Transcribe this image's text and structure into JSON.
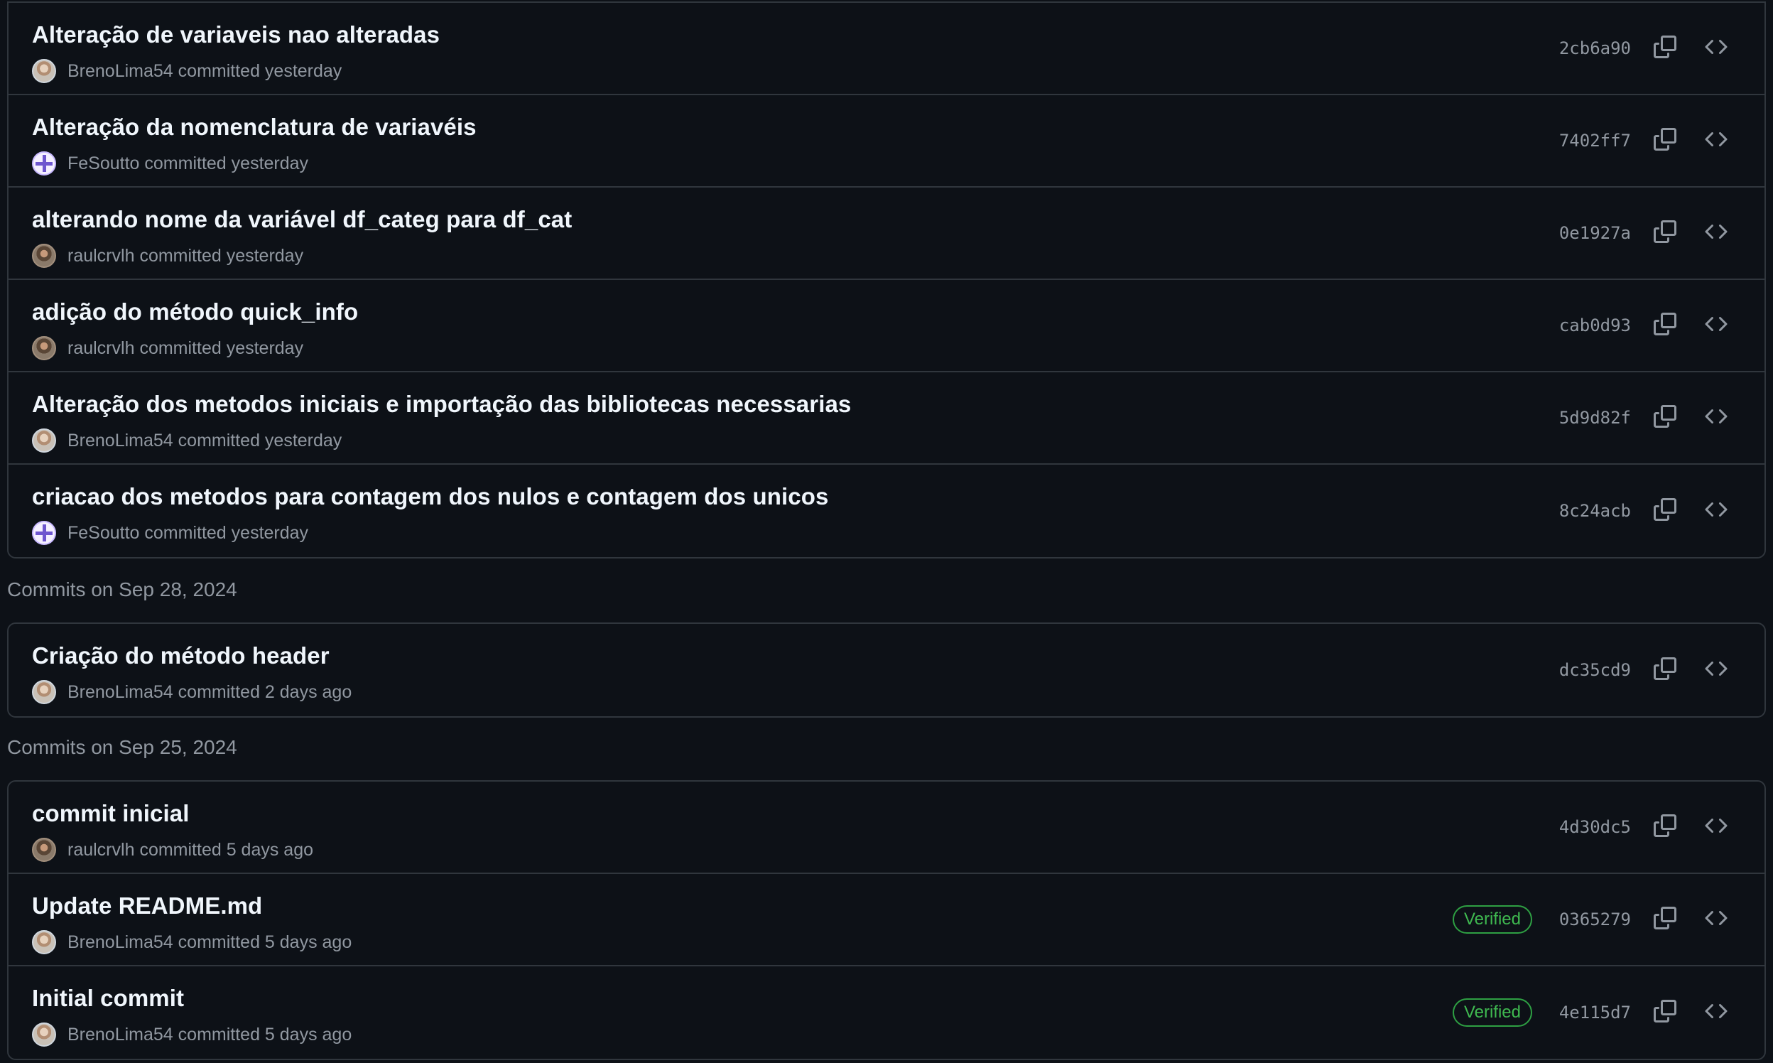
{
  "groups": [
    {
      "heading": "",
      "commits": [
        {
          "message": "Alteração de variaveis nao alteradas",
          "author": "BrenoLima54",
          "avatar": "photo",
          "action": "committed yesterday",
          "sha": "2cb6a90",
          "verified": ""
        },
        {
          "message": "Alteração da nomenclatura de variavéis",
          "author": "FeSoutto",
          "avatar": "ident",
          "action": "committed yesterday",
          "sha": "7402ff7",
          "verified": ""
        },
        {
          "message": "alterando nome da variável df_categ para df_cat",
          "author": "raulcrvlh",
          "avatar": "photo2",
          "action": "committed yesterday",
          "sha": "0e1927a",
          "verified": ""
        },
        {
          "message": "adição do método quick_info",
          "author": "raulcrvlh",
          "avatar": "photo2",
          "action": "committed yesterday",
          "sha": "cab0d93",
          "verified": ""
        },
        {
          "message": "Alteração dos metodos iniciais e importação das bibliotecas necessarias",
          "author": "BrenoLima54",
          "avatar": "photo",
          "action": "committed yesterday",
          "sha": "5d9d82f",
          "verified": ""
        },
        {
          "message": "criacao dos metodos para contagem dos nulos e contagem dos unicos",
          "author": "FeSoutto",
          "avatar": "ident",
          "action": "committed yesterday",
          "sha": "8c24acb",
          "verified": ""
        }
      ]
    },
    {
      "heading": "Commits on Sep 28, 2024",
      "commits": [
        {
          "message": "Criação do método header",
          "author": "BrenoLima54",
          "avatar": "photo",
          "action": "committed 2 days ago",
          "sha": "dc35cd9",
          "verified": ""
        }
      ]
    },
    {
      "heading": "Commits on Sep 25, 2024",
      "commits": [
        {
          "message": "commit inicial",
          "author": "raulcrvlh",
          "avatar": "photo2",
          "action": "committed 5 days ago",
          "sha": "4d30dc5",
          "verified": ""
        },
        {
          "message": "Update README.md",
          "author": "BrenoLima54",
          "avatar": "photo",
          "action": "committed 5 days ago",
          "sha": "0365279",
          "verified": "Verified"
        },
        {
          "message": "Initial commit",
          "author": "BrenoLima54",
          "avatar": "photo",
          "action": "committed 5 days ago",
          "sha": "4e115d7",
          "verified": "Verified"
        }
      ]
    }
  ],
  "icons": {
    "copy": "copy-icon",
    "browse": "code-icon"
  },
  "colors": {
    "background": "#0d1117",
    "border": "#30363d",
    "verified": "#3fb950"
  }
}
